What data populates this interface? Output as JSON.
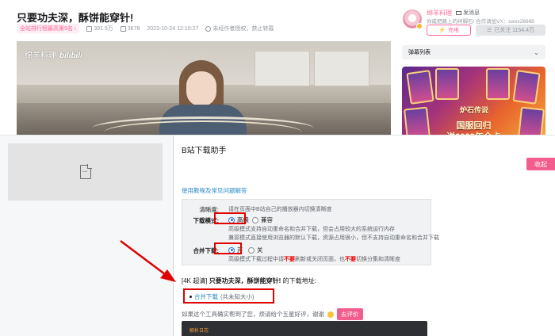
{
  "video": {
    "title": "只要功夫深，酥饼能穿针!",
    "rank_tag": "全站排行榜最高第9名",
    "rank_chevron": "›",
    "views": "391.5万",
    "danmaku_count": "3678",
    "publish_time": "2023-10-24 12:10:27",
    "copyright_notice": "未经作者授权，禁止转载",
    "watermark_name": "绵羊料理",
    "watermark_logo": "bilibili"
  },
  "uploader": {
    "name": "绵羊料理",
    "message_label": "发消息",
    "description": "你戚把路上的绊脚石! 合作请加VX：swxx26668",
    "charge_label": "充电",
    "follow_label": "已关注 1154.4万"
  },
  "sidebar": {
    "danmaku_list_label": "弹幕列表",
    "danmaku_chevron": "⌄",
    "ad": {
      "game_logo": "炉石传说",
      "line1": "国服回归",
      "line2": "送2023年全卡"
    }
  },
  "helper": {
    "title": "B站下载助手",
    "close_label": "收起",
    "help_link": "使用教程及常见问题解答",
    "clarity_label": "清晰度:",
    "clarity_text": "请在页面中B站自己的播放器内切换清晰度",
    "mode_label": "下载模式:",
    "mode_options": [
      "高级",
      "兼容"
    ],
    "mode_selected": "高级",
    "mode_desc_1": "高级模式支持自动重命名和合并下载，但会占用较大的系统运行内存",
    "mode_desc_2": "兼容模式直接使用浏览器的默认下载，资源占用很小，但不支持自动重命名和合并下载",
    "merge_label": "合并下载:",
    "merge_options": [
      "开",
      "关"
    ],
    "merge_selected": "开",
    "merge_desc_before": "高级模式下载过程中请",
    "merge_desc_red_1": "不要",
    "merge_desc_mid": "刷新或关闭页面，也",
    "merge_desc_red_2": "不要",
    "merge_desc_after": "切换分集和清晰度",
    "download_quality": "[4K 超清]",
    "download_title": "只要功夫深，酥饼能穿针!",
    "download_suffix": "的下载地址:",
    "merge_download_link": "合并下载",
    "merge_download_size": "(共未知大小)",
    "review_text": "如果这个工具确实帮到了您，烦请给个五星好评，谢谢",
    "review_button": "去评价",
    "dark_box_text": "解析日志"
  },
  "colors": {
    "accent_pink": "#ff6699",
    "link_blue": "#2b8ac6",
    "annotation_red": "#e00000"
  }
}
